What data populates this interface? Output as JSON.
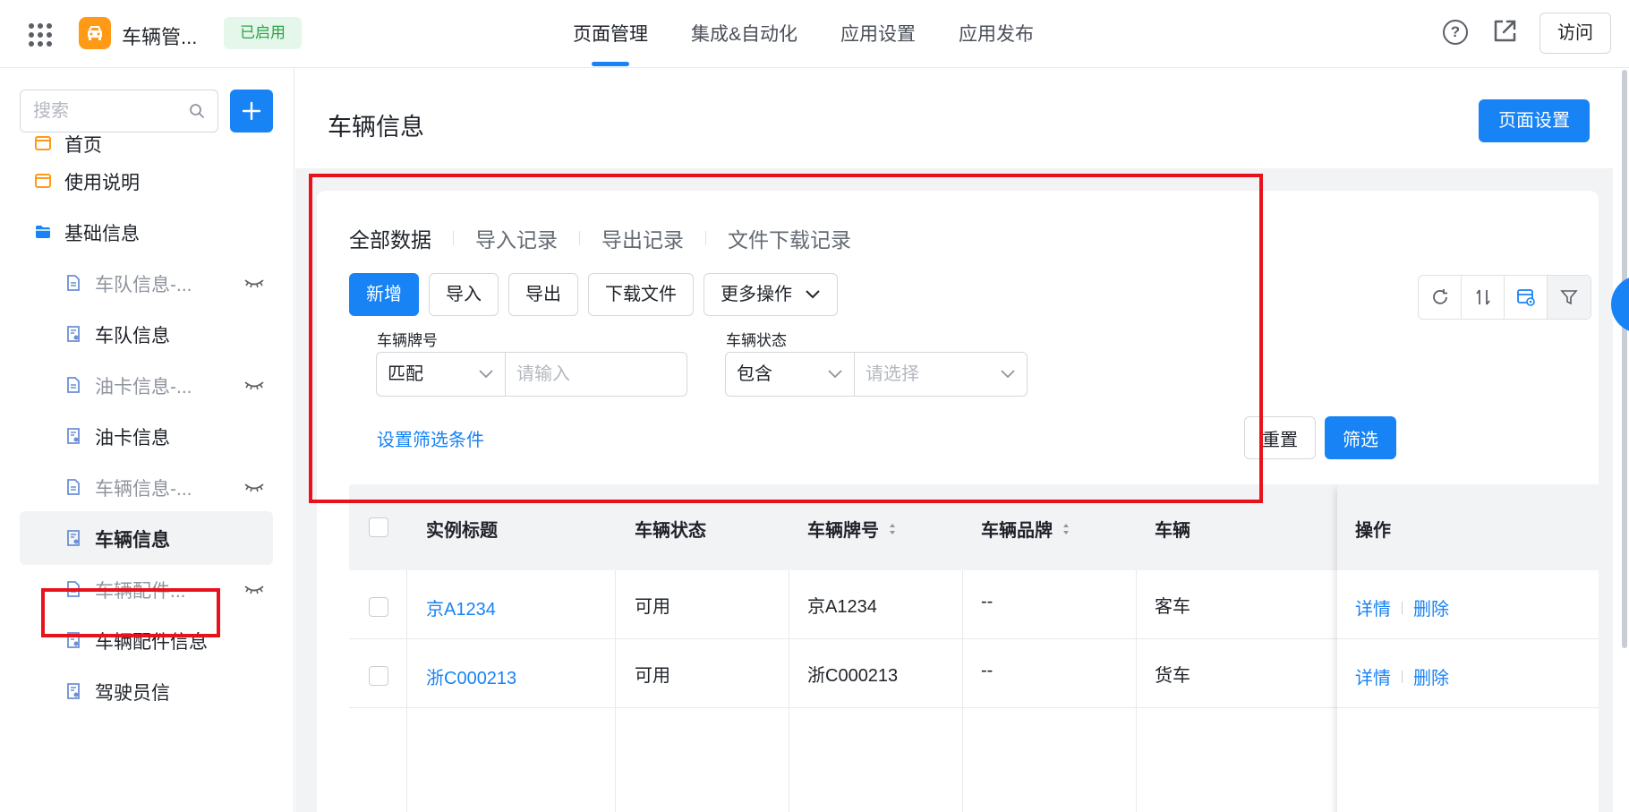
{
  "app": {
    "name": "车辆管...",
    "status": "已启用",
    "colors": {
      "accent": "#1883f4",
      "logo": "#ff9a17",
      "status_bg": "#e5f7ea",
      "status_text": "#2ba348",
      "highlight": "#e8121c"
    }
  },
  "nav": {
    "items": [
      {
        "label": "页面管理",
        "active": true
      },
      {
        "label": "集成&自动化",
        "active": false
      },
      {
        "label": "应用设置",
        "active": false
      },
      {
        "label": "应用发布",
        "active": false
      }
    ],
    "visit_label": "访问",
    "icons": [
      "help-icon",
      "open-external-icon"
    ]
  },
  "sidebar": {
    "search_placeholder": "搜索",
    "partial_item": "首页",
    "items": [
      {
        "label": "使用说明",
        "icon": "folder-icon",
        "level": 0
      },
      {
        "label": "基础信息",
        "icon": "folder-open-icon",
        "level": 0
      },
      {
        "label": "车队信息-...",
        "icon": "document-icon",
        "level": 1,
        "hidden": true
      },
      {
        "label": "车队信息",
        "icon": "form-icon",
        "level": 1
      },
      {
        "label": "油卡信息-...",
        "icon": "document-icon",
        "level": 1,
        "hidden": true
      },
      {
        "label": "油卡信息",
        "icon": "form-icon",
        "level": 1
      },
      {
        "label": "车辆信息-...",
        "icon": "document-icon",
        "level": 1,
        "hidden": true
      },
      {
        "label": "车辆信息",
        "icon": "form-icon",
        "level": 1,
        "active": true
      },
      {
        "label": "车辆配件...",
        "icon": "document-icon",
        "level": 1,
        "hidden": true
      },
      {
        "label": "车辆配件信息",
        "icon": "form-icon",
        "level": 1
      },
      {
        "label": "驾驶员信",
        "icon": "form-icon",
        "level": 1
      }
    ]
  },
  "main": {
    "title": "车辆信息",
    "page_settings_label": "页面设置",
    "tabs": [
      {
        "label": "全部数据",
        "active": true
      },
      {
        "label": "导入记录",
        "active": false
      },
      {
        "label": "导出记录",
        "active": false
      },
      {
        "label": "文件下载记录",
        "active": false
      }
    ],
    "actions": {
      "add": "新增",
      "import": "导入",
      "export": "导出",
      "download": "下载文件",
      "more": "更多操作"
    },
    "tools": [
      "refresh-icon",
      "sort-icon",
      "view-settings-icon",
      "filter-icon"
    ],
    "filters": [
      {
        "label": "车辆牌号",
        "operator": "匹配",
        "placeholder": "请输入"
      },
      {
        "label": "车辆状态",
        "operator": "包含",
        "placeholder": "请选择"
      }
    ],
    "set_filter_label": "设置筛选条件",
    "reset_label": "重置",
    "filter_label": "筛选"
  },
  "table": {
    "columns": [
      "实例标题",
      "车辆状态",
      "车辆牌号",
      "车辆品牌",
      "车辆",
      "操作"
    ],
    "rows": [
      {
        "title": "京A1234",
        "status": "可用",
        "plate": "京A1234",
        "brand": "--",
        "type": "客车"
      },
      {
        "title": "浙C000213",
        "status": "可用",
        "plate": "浙C000213",
        "brand": "--",
        "type": "货车"
      }
    ],
    "row_actions": {
      "detail": "详情",
      "delete": "删除"
    }
  }
}
